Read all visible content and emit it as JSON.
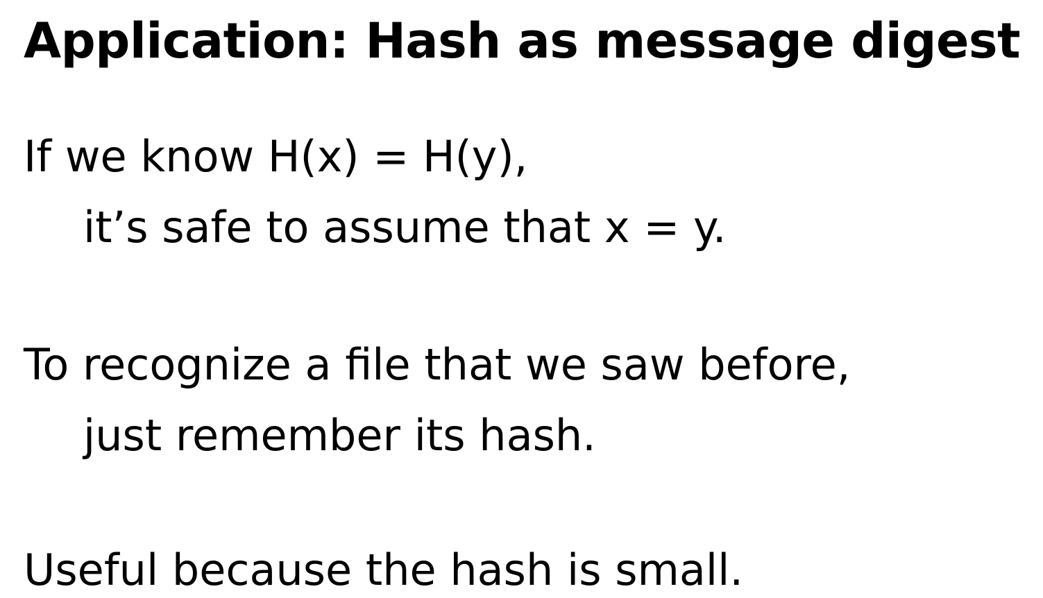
{
  "slide": {
    "title": "Application: Hash as message digest",
    "paragraphs": [
      {
        "line1": "If we know H(x) = H(y),",
        "line2": "it’s safe to assume that x = y."
      },
      {
        "line1": "To recognize a file that we saw before,",
        "line2": "just remember its hash."
      },
      {
        "line1": "Useful because the hash is small."
      }
    ]
  }
}
